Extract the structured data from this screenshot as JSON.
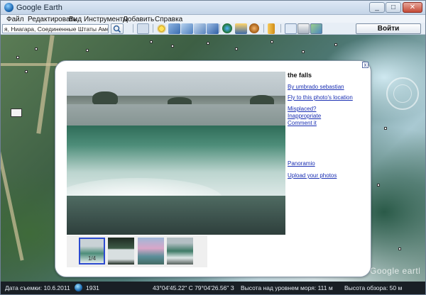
{
  "window": {
    "title": "Google Earth",
    "controls": {
      "minimize": "_",
      "maximize": "□",
      "close": "✕"
    }
  },
  "menu": [
    "Файл",
    "Редактировать",
    "Вид",
    "Инструменты",
    "Добавить",
    "Справка"
  ],
  "search": {
    "value": "я, Ниагара, Соединенные Штаты Америки",
    "go_label": "Войти"
  },
  "toolbar": {
    "icons": [
      "sidebar-toggle-icon",
      "placemark-icon",
      "polygon-icon",
      "path-icon",
      "image-overlay-icon",
      "tour-icon",
      "historical-imagery-icon",
      "sunlight-icon",
      "planets-icon",
      "ruler-icon",
      "email-icon",
      "print-icon",
      "maps-icon"
    ]
  },
  "balloon": {
    "title": "the falls",
    "links": [
      "By umbrado sebastian",
      "Fly to this photo's location",
      "Misplaced?",
      "Inappropriate",
      "Comment it",
      "Panoramio",
      "Upload your photos"
    ],
    "close_label": "x",
    "thumb_counter": "1/4"
  },
  "statusbar": {
    "imagery_date": "Дата съемки: 10.6.2011",
    "year": "1931",
    "coordinates": "43°04'45.22\" С  79°04'26.56\" З",
    "elevation": "Высота над уровнем моря: 111 м",
    "eye_alt": "Высота обзора: 50 м"
  },
  "brand": {
    "watermark": "Google earth"
  },
  "colors": {
    "link": "#1a2fb3",
    "selection": "#2d4bd0",
    "status_bg": "#0a0e14"
  }
}
